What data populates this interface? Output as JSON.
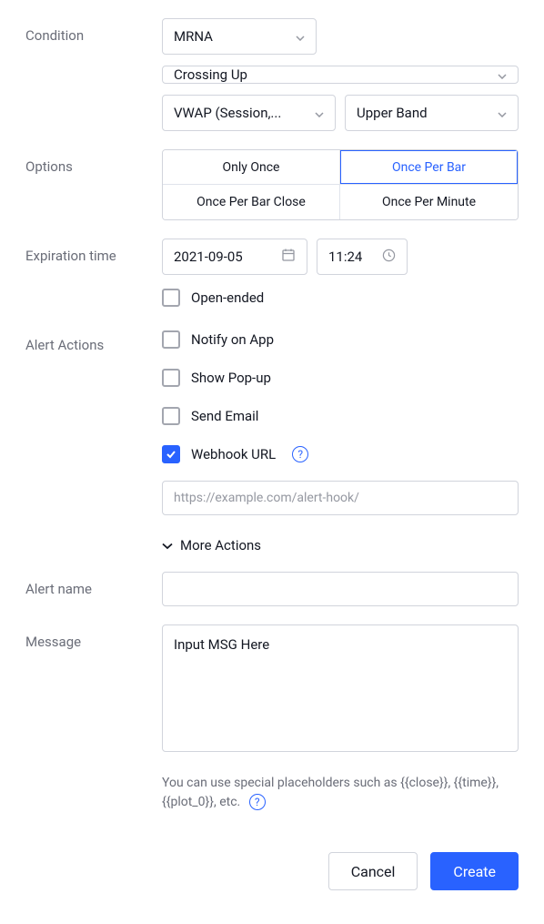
{
  "labels": {
    "condition": "Condition",
    "options": "Options",
    "expiration": "Expiration time",
    "alert_actions": "Alert Actions",
    "alert_name": "Alert name",
    "message": "Message"
  },
  "condition": {
    "symbol": "MRNA",
    "trigger": "Crossing Up",
    "indicator": "VWAP (Session,...",
    "band": "Upper Band"
  },
  "options": {
    "items": [
      "Only Once",
      "Once Per Bar",
      "Once Per Bar Close",
      "Once Per Minute"
    ],
    "selected_index": 1
  },
  "expiration": {
    "date": "2021-09-05",
    "time": "11:24",
    "open_ended_label": "Open-ended",
    "open_ended_checked": false
  },
  "actions": {
    "items": [
      {
        "label": "Notify on App",
        "checked": false
      },
      {
        "label": "Show Pop-up",
        "checked": false
      },
      {
        "label": "Send Email",
        "checked": false
      },
      {
        "label": "Webhook URL",
        "checked": true,
        "help": true
      }
    ],
    "webhook_placeholder": "https://example.com/alert-hook/",
    "more_label": "More Actions"
  },
  "alert_name": "",
  "message": {
    "value": "Input MSG Here",
    "hint": "You can use special placeholders such as {{close}}, {{time}}, {{plot_0}}, etc."
  },
  "footer": {
    "cancel": "Cancel",
    "create": "Create"
  }
}
